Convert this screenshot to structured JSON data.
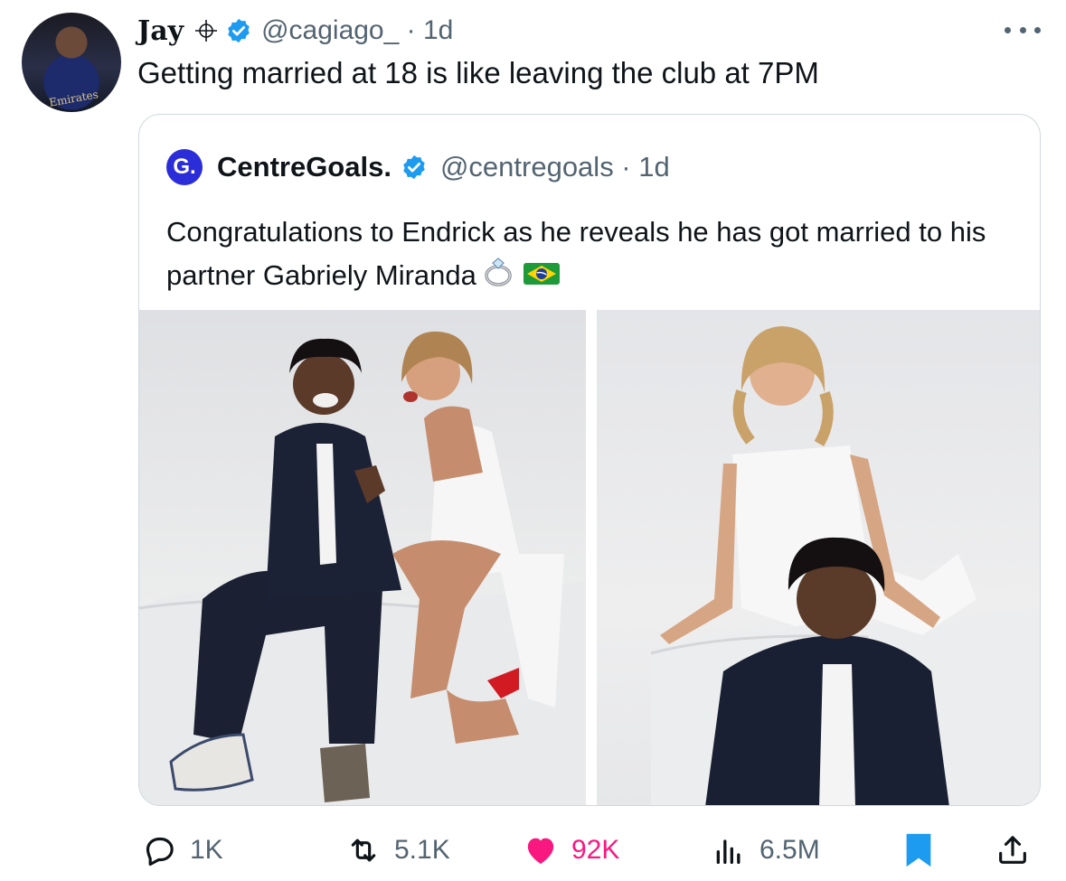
{
  "tweet": {
    "author_name": "Jay",
    "handle_time": "@cagiago_ · 1d",
    "text": "Getting married at 18 is like leaving the club at 7PM",
    "avatar_caption": "Emirates"
  },
  "quoted": {
    "avatar_letter": "G.",
    "author_name": "CentreGoals.",
    "handle_time": "@centregoals · 1d",
    "text": "Congratulations to Endrick as he reveals he has got married to his partner Gabriely Miranda",
    "emojis": [
      "ring-emoji",
      "brazil-flag-emoji"
    ]
  },
  "actions": {
    "replies": "1K",
    "reposts": "5.1K",
    "likes": "92K",
    "views": "6.5M"
  },
  "colors": {
    "verified": "#1d9bf0",
    "like": "#f91880",
    "bookmark": "#1d9bf0",
    "secondary_text": "#536471"
  }
}
